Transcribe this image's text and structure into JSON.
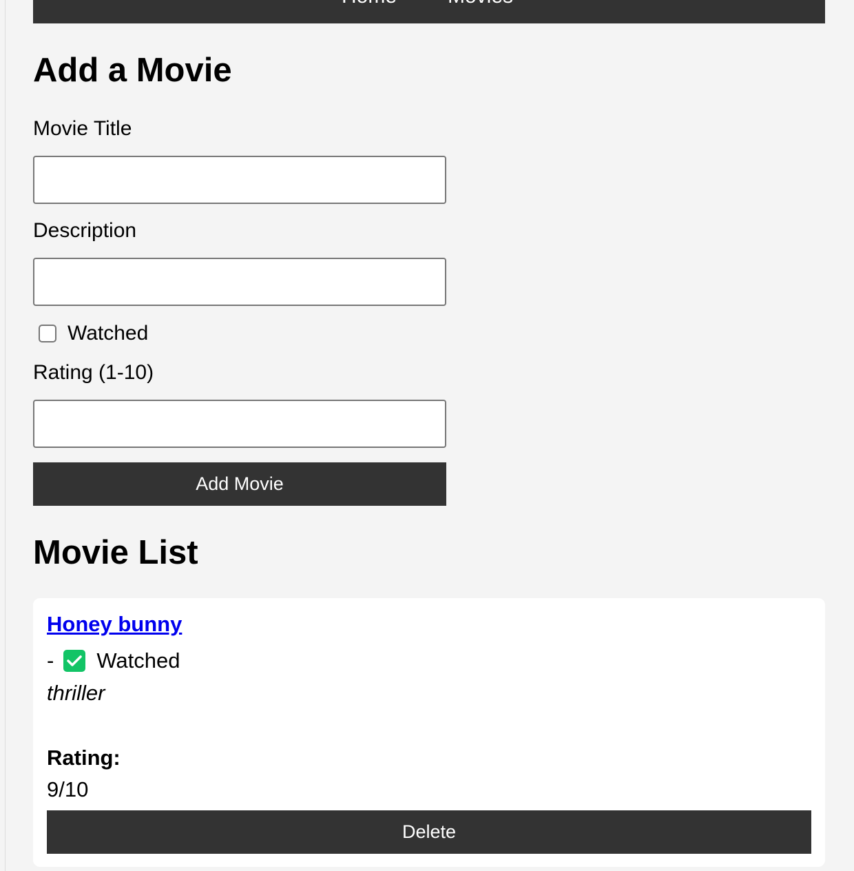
{
  "nav": {
    "items": [
      {
        "label": "Home"
      },
      {
        "label": "Movies"
      }
    ]
  },
  "form": {
    "heading": "Add a Movie",
    "title_label": "Movie Title",
    "title_value": "",
    "description_label": "Description",
    "description_value": "",
    "watched_label": "Watched",
    "watched_checked": false,
    "rating_label": "Rating (1-10)",
    "rating_value": "",
    "submit_label": "Add Movie"
  },
  "list": {
    "heading": "Movie List",
    "movies": [
      {
        "title": "Honey bunny",
        "dash": "-",
        "status_icon": "check-mark-button-icon",
        "status": "Watched",
        "description": "thriller",
        "rating_label": "Rating:",
        "rating": "9/10",
        "delete_label": "Delete"
      }
    ]
  },
  "colors": {
    "background": "#f4f4f4",
    "nav_background": "#333333",
    "button_background": "#333333",
    "button_text": "#ffffff",
    "link": "#0000ee",
    "watched_check": "#12c466",
    "card_background": "#ffffff"
  }
}
